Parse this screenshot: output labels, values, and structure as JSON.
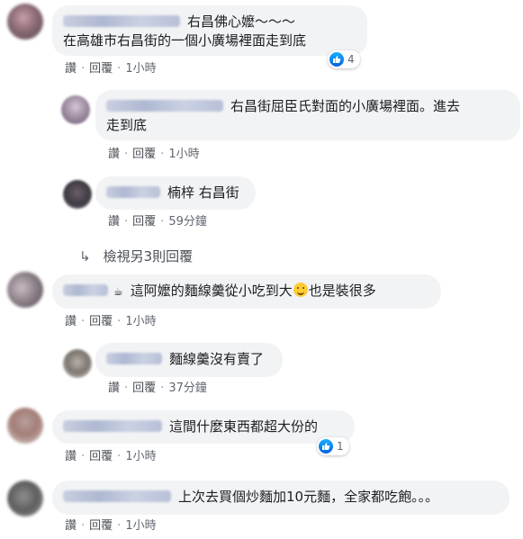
{
  "comments": [
    {
      "text_line1": "右昌佛心嬤～～～",
      "text_line2": "在高雄市右昌街的一個小廣場裡面走到底",
      "reactions": "4",
      "like": "讚",
      "reply": "回覆",
      "time": "1小時",
      "replies": [
        {
          "text_line1": "右昌街屈臣氏對面的小廣場裡面。進去",
          "text_line2": "走到底",
          "like": "讚",
          "reply": "回覆",
          "time": "1小時"
        },
        {
          "text": "楠梓 右昌街",
          "like": "讚",
          "reply": "回覆",
          "time": "59分鐘"
        }
      ],
      "more_replies": "檢視另3則回覆"
    },
    {
      "text_before": "這阿嬤的麵線羹從小吃到大",
      "text_after": "也是裝很多",
      "like": "讚",
      "reply": "回覆",
      "time": "1小時",
      "replies": [
        {
          "text": "麵線羹沒有賣了",
          "like": "讚",
          "reply": "回覆",
          "time": "37分鐘"
        }
      ]
    },
    {
      "text": "這間什麼東西都超大份的",
      "reactions": "1",
      "like": "讚",
      "reply": "回覆",
      "time": "1小時"
    },
    {
      "text": "上次去買個炒麵加10元麵，全家都吃飽。。。",
      "like": "讚",
      "reply": "回覆",
      "time": "1小時"
    }
  ],
  "icons": {
    "reaction": "like-thumb-icon",
    "more": "reply-arrow-icon",
    "emoji": "smiling-face-icon",
    "cup": "coffee-cup-icon"
  },
  "colors": {
    "bubble": "#f2f3f5",
    "like_blue": "#1877f2",
    "meta": "#616770"
  }
}
